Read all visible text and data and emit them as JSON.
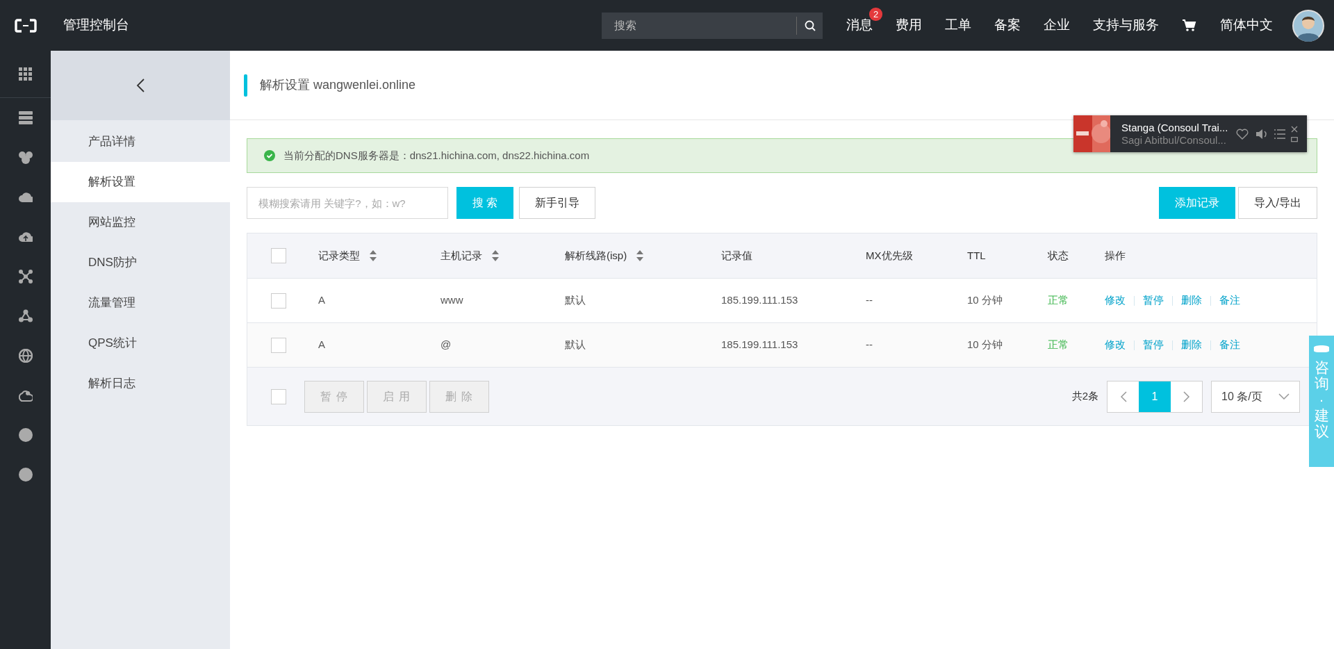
{
  "topbar": {
    "title": "管理控制台",
    "search": {
      "placeholder": "搜索"
    },
    "nav": [
      {
        "label": "消息",
        "badge": "2"
      },
      {
        "label": "费用"
      },
      {
        "label": "工单"
      },
      {
        "label": "备案"
      },
      {
        "label": "企业"
      },
      {
        "label": "支持与服务"
      }
    ],
    "language": "简体中文"
  },
  "sidebar": {
    "items": [
      {
        "label": "产品详情",
        "selected": false
      },
      {
        "label": "解析设置",
        "selected": true
      },
      {
        "label": "网站监控",
        "selected": false
      },
      {
        "label": "DNS防护",
        "selected": false
      },
      {
        "label": "流量管理",
        "selected": false
      },
      {
        "label": "QPS统计",
        "selected": false
      },
      {
        "label": "解析日志",
        "selected": false
      }
    ]
  },
  "page_title": "解析设置 wangwenlei.online",
  "alert": "当前分配的DNS服务器是：dns21.hichina.com, dns22.hichina.com",
  "toolbar": {
    "search": {
      "placeholder": "模糊搜索请用 关键字?，如：w?"
    },
    "left_buttons": [
      {
        "label": "搜 索",
        "kind": "primary"
      },
      {
        "label": "新手引导",
        "kind": "default"
      }
    ],
    "right_buttons": [
      {
        "label": "添加记录",
        "kind": "primary"
      },
      {
        "label": "导入/导出",
        "kind": "default"
      }
    ]
  },
  "table": {
    "select_all": {
      "checked": false
    },
    "columns": [
      {
        "label": "记录类型",
        "sortable": true
      },
      {
        "label": "主机记录",
        "sortable": true
      },
      {
        "label": "解析线路(isp)",
        "sortable": true
      },
      {
        "label": "记录值",
        "sortable": false
      },
      {
        "label": "MX优先级",
        "sortable": false
      },
      {
        "label": "TTL",
        "sortable": false
      },
      {
        "label": "状态",
        "sortable": false
      },
      {
        "label": "操作",
        "sortable": false
      }
    ],
    "rows": [
      {
        "checked": false,
        "cells": [
          "A",
          "www",
          "默认",
          "185.199.111.153",
          "--",
          "10 分钟"
        ],
        "status": "正常",
        "actions": [
          "修改",
          "暂停",
          "删除",
          "备注"
        ]
      },
      {
        "checked": false,
        "cells": [
          "A",
          "@",
          "默认",
          "185.199.111.153",
          "--",
          "10 分钟"
        ],
        "status": "正常",
        "actions": [
          "修改",
          "暂停",
          "删除",
          "备注"
        ]
      }
    ]
  },
  "footer": {
    "select_all": {
      "checked": false
    },
    "bulk_buttons": [
      {
        "label": "暂 停",
        "disabled": true
      },
      {
        "label": "启 用",
        "disabled": true
      },
      {
        "label": "删 除",
        "disabled": true
      }
    ],
    "total": "共2条",
    "pages": [
      {
        "label": "1",
        "selected": true
      }
    ],
    "page_size": "10 条/页"
  },
  "player": {
    "title": "Stanga (Consoul Trai...",
    "artist": "Sagi Abitbul/Consoul..."
  },
  "consult_tab": "咨询·建议"
}
